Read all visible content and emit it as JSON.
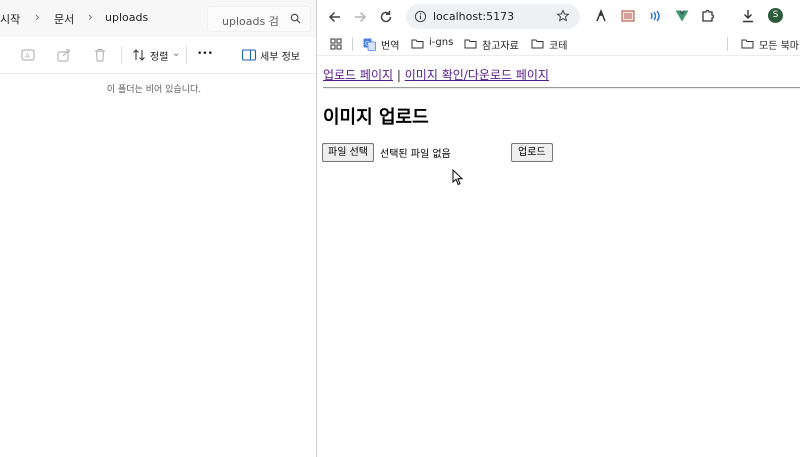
{
  "explorer": {
    "breadcrumbs": [
      "시작",
      "문서",
      "uploads"
    ],
    "search_placeholder": "uploads 검",
    "toolbar": {
      "sort_label": "정렬",
      "more_label": "•••",
      "details_label": "세부 정보"
    },
    "empty_message": "이 폴더는 비어 있습니다."
  },
  "browser": {
    "url": "localhost:5173",
    "profile_initial": "S",
    "bookmarks": [
      {
        "label": "번역",
        "icon": "translate-icon"
      },
      {
        "label": "i-gns",
        "icon": "folder-icon"
      },
      {
        "label": "참고자료",
        "icon": "folder-icon"
      },
      {
        "label": "코테",
        "icon": "folder-icon"
      }
    ],
    "all_bookmarks_label": "모든 북마",
    "page": {
      "nav_upload_link": "업로드 페이지",
      "nav_separator": "|",
      "nav_view_link": "이미지 확인/다운로드 페이지",
      "title": "이미지 업로드",
      "file_button": "파일 선택",
      "file_status": "선택된 파일 없음",
      "upload_button": "업로드"
    }
  },
  "colors": {
    "visited_link": "#551a8b",
    "profile_bg": "#2c5c3a",
    "omnibox_bg": "#eef0f3"
  }
}
